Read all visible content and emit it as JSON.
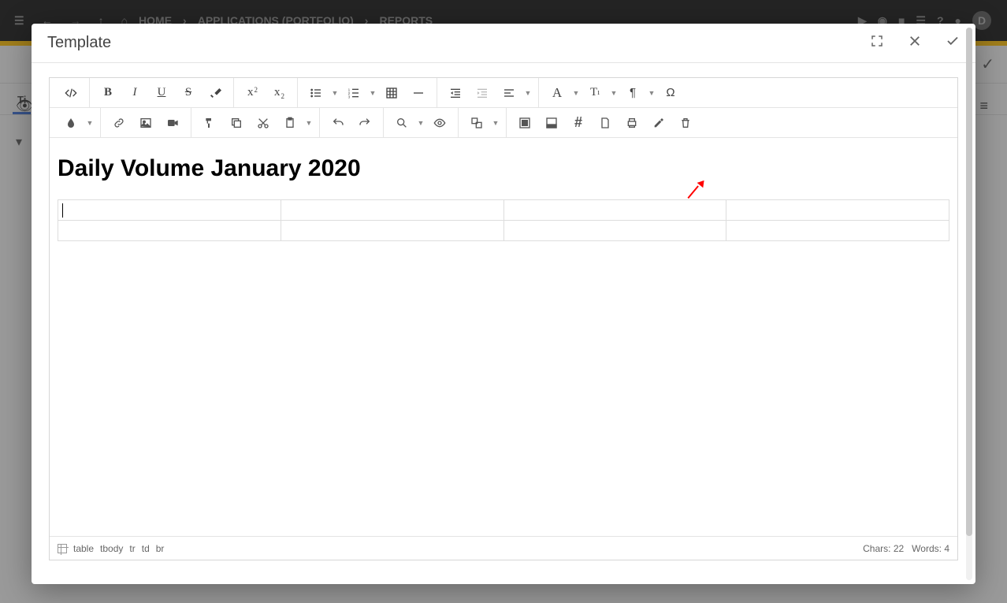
{
  "bg": {
    "breadcrumb": [
      "HOME",
      "APPLICATIONS (PORTFOLIO)",
      "REPORTS"
    ],
    "tab_label": "Ti"
  },
  "modal": {
    "title": "Template"
  },
  "document": {
    "heading": "Daily Volume January 2020",
    "table": {
      "rows": 2,
      "cols": 4
    }
  },
  "status": {
    "path": [
      "table",
      "tbody",
      "tr",
      "td",
      "br"
    ],
    "chars_label": "Chars:",
    "chars_value": "22",
    "words_label": "Words:",
    "words_value": "4"
  }
}
